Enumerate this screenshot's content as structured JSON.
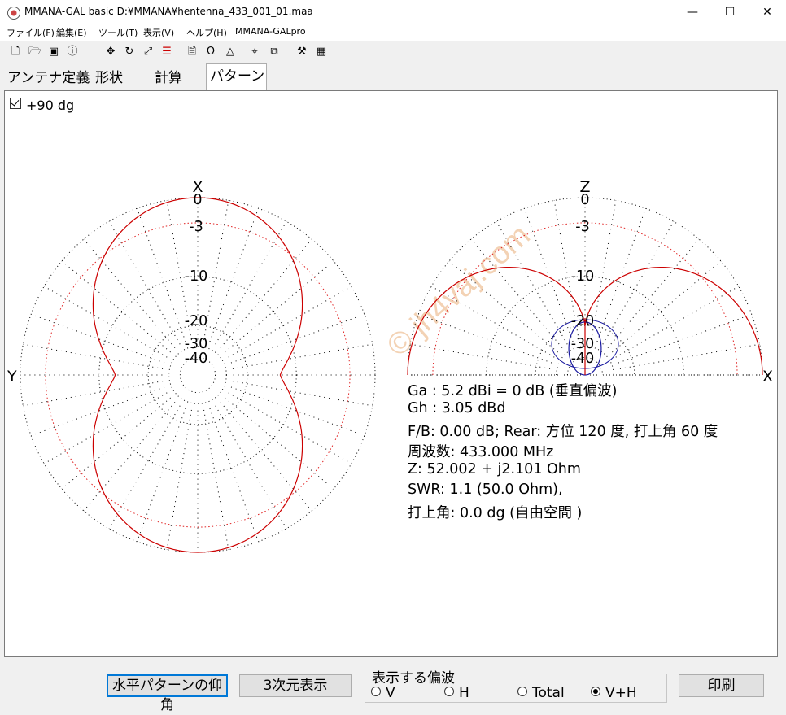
{
  "window": {
    "title": "MMANA-GAL basic  D:¥MMANA¥hentenna_433_001_01.maa",
    "minimize": "—",
    "maximize": "☐",
    "close": "✕"
  },
  "menu": [
    "ファイル(F)",
    "編集(E)",
    "ツール(T)",
    "表示(V)",
    "ヘルプ(H)",
    "MMANA-GALpro"
  ],
  "tabs": [
    "アンテナ定義",
    "形状",
    "計算",
    "パターン"
  ],
  "active_tab": "パターン",
  "checkbox": {
    "label": "+90 dg",
    "checked": true
  },
  "watermark": "© jh4vaj.com",
  "horizontal_pattern": {
    "axis_top": "X",
    "axis_left": "Y",
    "ring_labels": [
      "0",
      "-3",
      "-10",
      "-20",
      "-30",
      "-40"
    ],
    "color": "#cc0000"
  },
  "vertical_pattern": {
    "axis_top": "Z",
    "axis_right": "X",
    "ring_labels": [
      "0",
      "-3",
      "-10",
      "-20",
      "-30",
      "-40"
    ],
    "color_vh": "#cc0000",
    "color_h": "#1a1aa0"
  },
  "info_lines": [
    "Ga : 5.2 dBi = 0 dB  (垂直偏波)",
    "Gh : 3.05 dBd",
    "F/B: 0.00 dB; Rear: 方位 120 度,  打上角 60 度",
    "周波数: 433.000 MHz",
    "Z: 52.002 + j2.101 Ohm",
    "SWR: 1.1 (50.0 Ohm),",
    "打上角: 0.0 dg (自由空間 )"
  ],
  "buttons": {
    "elevation": "水平パターンの仰角",
    "view3d": "3次元表示",
    "print": "印刷"
  },
  "polarization": {
    "title": "表示する偏波",
    "options": [
      "V",
      "H",
      "Total",
      "V+H"
    ],
    "selected": "V+H"
  }
}
